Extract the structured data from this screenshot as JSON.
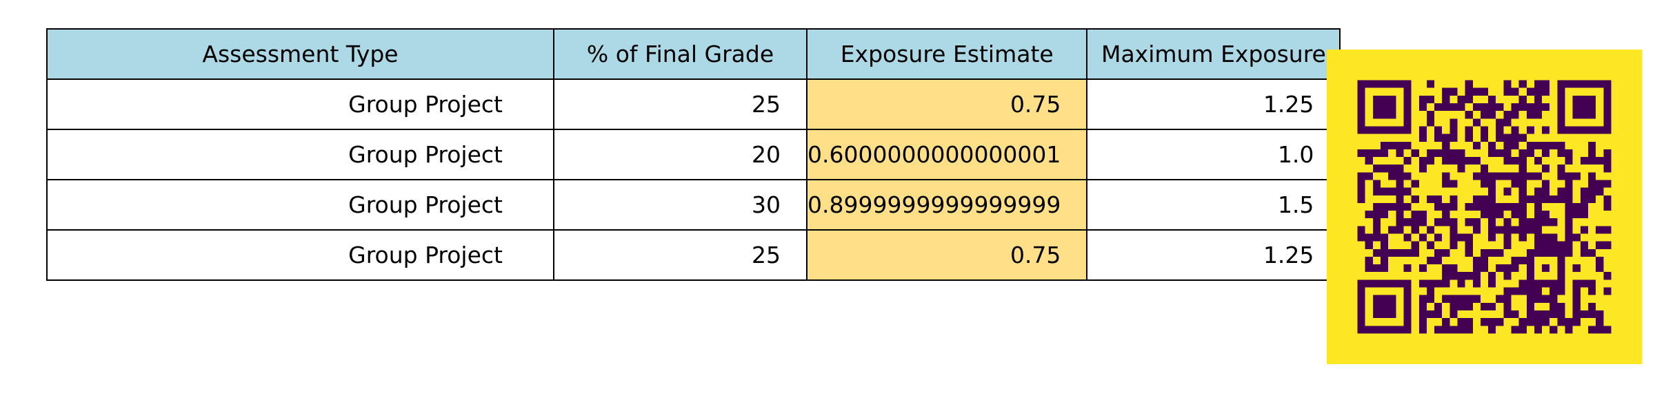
{
  "colors": {
    "header_fill": "#add8e6",
    "highlight_fill": "#ffdf88",
    "cell_fill": "#ffffff",
    "grid_line": "#000000",
    "qr_background": "#fde725",
    "qr_modules": "#440154"
  },
  "qr_icon": "qr-code",
  "chart_data": {
    "type": "table",
    "columns": [
      "Assessment Type",
      "% of Final Grade",
      "Exposure Estimate",
      "Maximum Exposure"
    ],
    "highlighted_column": "Exposure Estimate",
    "rows": [
      [
        "Group Project",
        "25",
        "0.75",
        "1.25"
      ],
      [
        "Group Project",
        "20",
        "0.6000000000000001",
        "1.0"
      ],
      [
        "Group Project",
        "30",
        "0.8999999999999999",
        "1.5"
      ],
      [
        "Group Project",
        "25",
        "0.75",
        "1.25"
      ]
    ]
  }
}
